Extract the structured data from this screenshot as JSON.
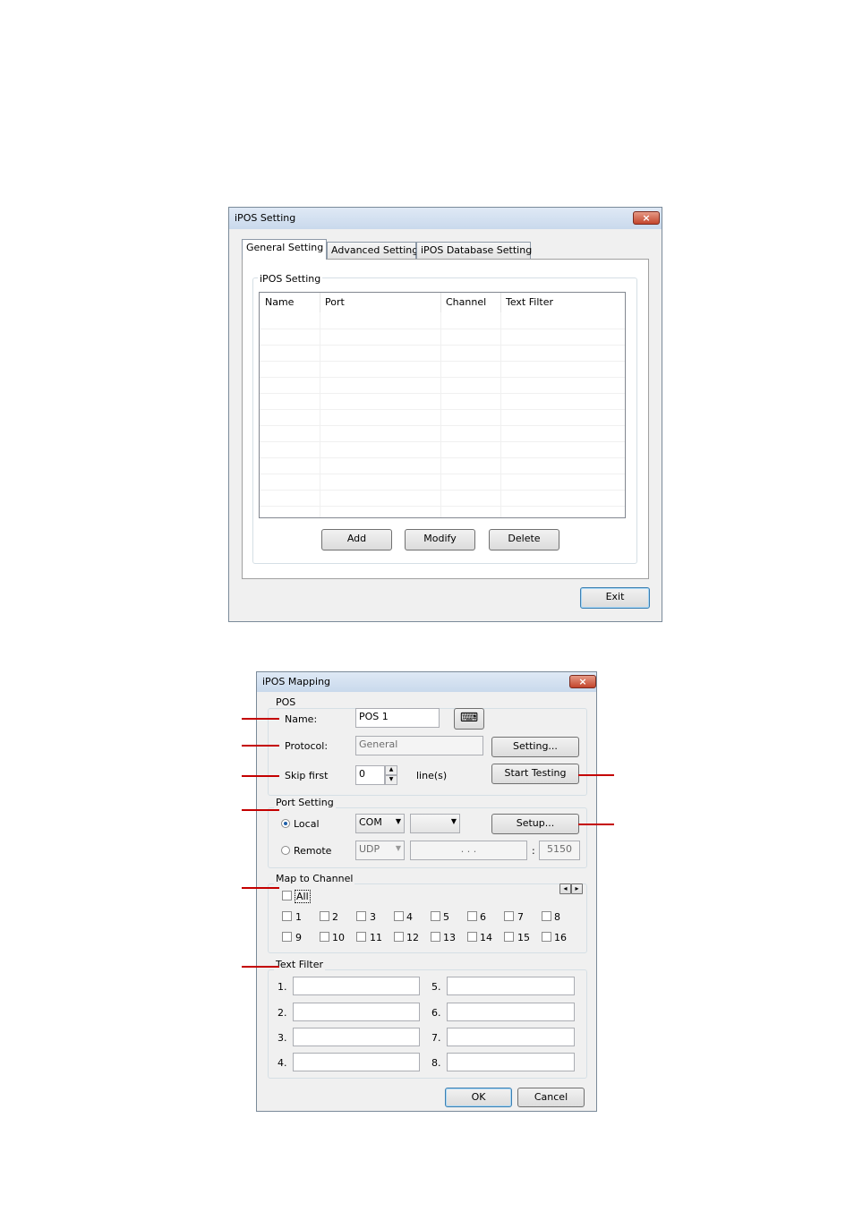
{
  "ipos_setting": {
    "title": "iPOS Setting",
    "close_icon": "×",
    "tabs": [
      {
        "label": "General Setting"
      },
      {
        "label": "Advanced Setting"
      },
      {
        "label": "iPOS Database Setting"
      }
    ],
    "group_label": "iPOS Setting",
    "columns": [
      "Name",
      "Port",
      "Channel",
      "Text Filter"
    ],
    "buttons": {
      "add": "Add",
      "modify": "Modify",
      "delete": "Delete",
      "exit": "Exit"
    }
  },
  "ipos_mapping": {
    "title": "iPOS Mapping",
    "close_icon": "×",
    "pos": {
      "group_label": "POS",
      "name_label": "Name:",
      "name_value": "POS 1",
      "keyboard_icon": "⌨",
      "protocol_label": "Protocol:",
      "protocol_value": "General",
      "setting_button": "Setting...",
      "skip_label": "Skip  first",
      "skip_value": "0",
      "lines_label": "line(s)",
      "start_testing_button": "Start Testing"
    },
    "port_setting": {
      "group_label": "Port Setting",
      "local_label": "Local",
      "local_type": "COM",
      "setup_button": "Setup...",
      "remote_label": "Remote",
      "remote_type": "UDP",
      "ip_dots": ".          .          .",
      "colon": ":",
      "port": "5150"
    },
    "map_to_channel": {
      "group_label": "Map to Channel",
      "all_label": "All",
      "scroll_left": "◂",
      "scroll_right": "▸",
      "channels": [
        "1",
        "2",
        "3",
        "4",
        "5",
        "6",
        "7",
        "8",
        "9",
        "10",
        "11",
        "12",
        "13",
        "14",
        "15",
        "16"
      ]
    },
    "text_filter": {
      "group_label": "Text Filter",
      "labels": [
        "1.",
        "2.",
        "3.",
        "4.",
        "5.",
        "6.",
        "7.",
        "8."
      ]
    },
    "buttons": {
      "ok": "OK",
      "cancel": "Cancel"
    }
  }
}
